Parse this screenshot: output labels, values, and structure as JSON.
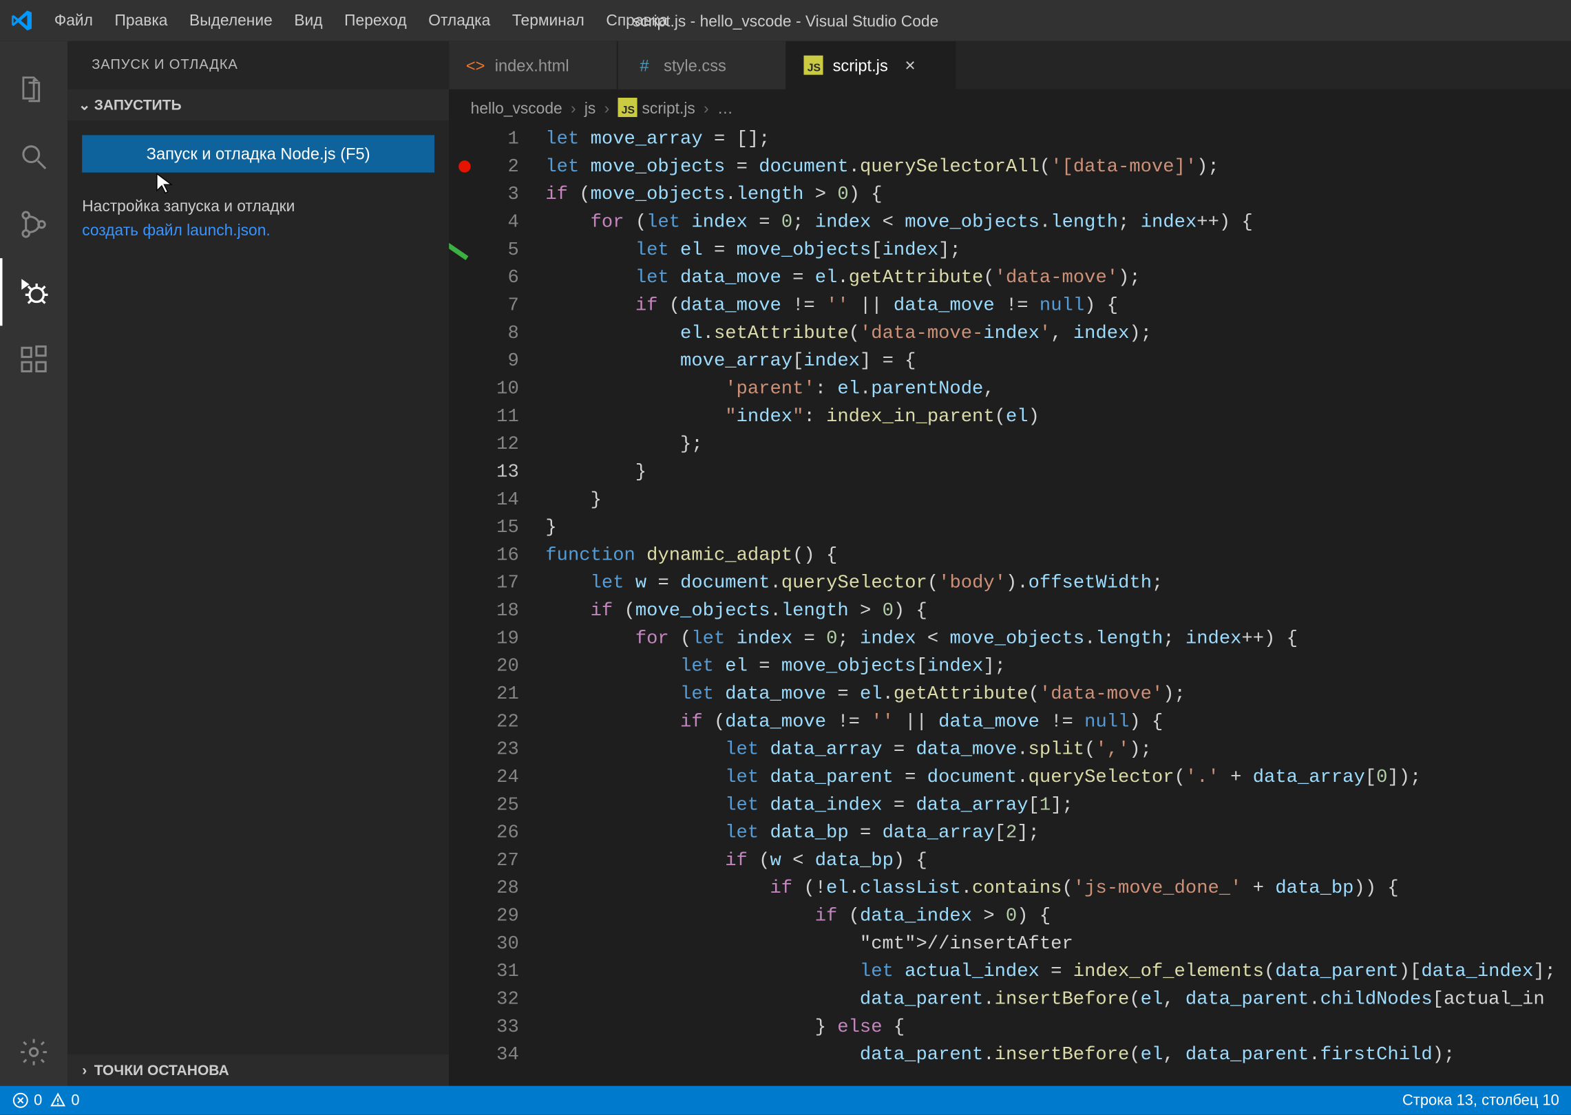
{
  "titlebar": {
    "title": "script.js - hello_vscode - Visual Studio Code",
    "menu": [
      "Файл",
      "Правка",
      "Выделение",
      "Вид",
      "Переход",
      "Отладка",
      "Терминал",
      "Справка"
    ]
  },
  "sidebar": {
    "title": "ЗАПУСК И ОТЛАДКА",
    "run_section": "ЗАПУСТИТЬ",
    "run_button": "Запуск и отладка Node.js (F5)",
    "config_text": "Настройка запуска и отладки",
    "config_link": "создать файл launch.json.",
    "breakpoints_section": "ТОЧКИ ОСТАНОВА"
  },
  "tabs": [
    {
      "label": "index.html",
      "icon": "html"
    },
    {
      "label": "style.css",
      "icon": "css"
    },
    {
      "label": "script.js",
      "icon": "js",
      "active": true
    }
  ],
  "breadcrumbs": [
    "hello_vscode",
    "js",
    "script.js",
    "…"
  ],
  "statusbar": {
    "errors": "0",
    "warnings": "0",
    "cursor": "Строка 13, столбец 10"
  },
  "code": {
    "line_count": 34,
    "current_line": 13,
    "breakpoint_line": 2,
    "lines": [
      "let move_array = [];",
      "let move_objects = document.querySelectorAll('[data-move]');",
      "if (move_objects.length > 0) {",
      "    for (let index = 0; index < move_objects.length; index++) {",
      "        let el = move_objects[index];",
      "        let data_move = el.getAttribute('data-move');",
      "        if (data_move != '' || data_move != null) {",
      "            el.setAttribute('data-move-index', index);",
      "            move_array[index] = {",
      "                'parent': el.parentNode,",
      "                \"index\": index_in_parent(el)",
      "            };",
      "        }",
      "    }",
      "}",
      "function dynamic_adapt() {",
      "    let w = document.querySelector('body').offsetWidth;",
      "    if (move_objects.length > 0) {",
      "        for (let index = 0; index < move_objects.length; index++) {",
      "            let el = move_objects[index];",
      "            let data_move = el.getAttribute('data-move');",
      "            if (data_move != '' || data_move != null) {",
      "                let data_array = data_move.split(',');",
      "                let data_parent = document.querySelector('.' + data_array[0]);",
      "                let data_index = data_array[1];",
      "                let data_bp = data_array[2];",
      "                if (w < data_bp) {",
      "                    if (!el.classList.contains('js-move_done_' + data_bp)) {",
      "                        if (data_index > 0) {",
      "                            //insertAfter",
      "                            let actual_index = index_of_elements(data_parent)[data_index];",
      "                            data_parent.insertBefore(el, data_parent.childNodes[actual_in",
      "                        } else {",
      "                            data_parent.insertBefore(el, data_parent.firstChild);"
    ]
  }
}
